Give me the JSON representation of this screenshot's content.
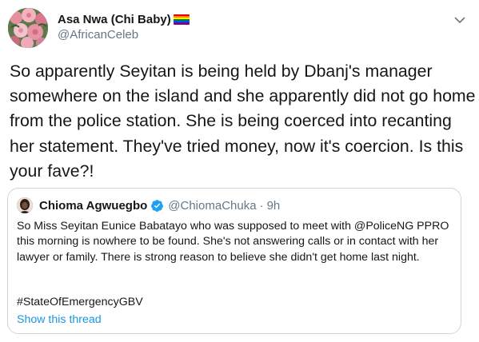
{
  "author": {
    "display_name": "Asa Nwa (Chi Baby)",
    "handle": "@AfricanCeleb",
    "avatar_icon": "rose-bouquet-avatar-icon",
    "flag_icon": "rainbow-flag-icon"
  },
  "tweet": {
    "text": "So apparently Seyitan is being held by Dbanj's manager somewhere on the island and she apparently did not go home from the police station. She is being coerced into recanting her statement. They've tried money, now it's coercion. Is this your fave?!"
  },
  "menu": {
    "icon": "chevron-down-icon"
  },
  "quoted_tweet": {
    "display_name": "Chioma Agwuegbo",
    "verified_icon": "verified-badge-icon",
    "handle": "@ChiomaChuka",
    "separator": "·",
    "time": "9h",
    "text": "So Miss Seyitan Eunice Babatayo who was supposed to meet with @PoliceNG PPRO this morning is nowhere to be found. She's not answering calls or in contact with her lawyer or family. There is strong reason to believe she didn't get home last night.",
    "hashtag": "#StateOfEmergencyGBV",
    "show_thread": "Show this thread"
  },
  "colors": {
    "text": "#14171a",
    "secondary": "#657786",
    "link": "#1b95e0",
    "verified": "#1da1f2",
    "border": "#ccd6dd"
  }
}
